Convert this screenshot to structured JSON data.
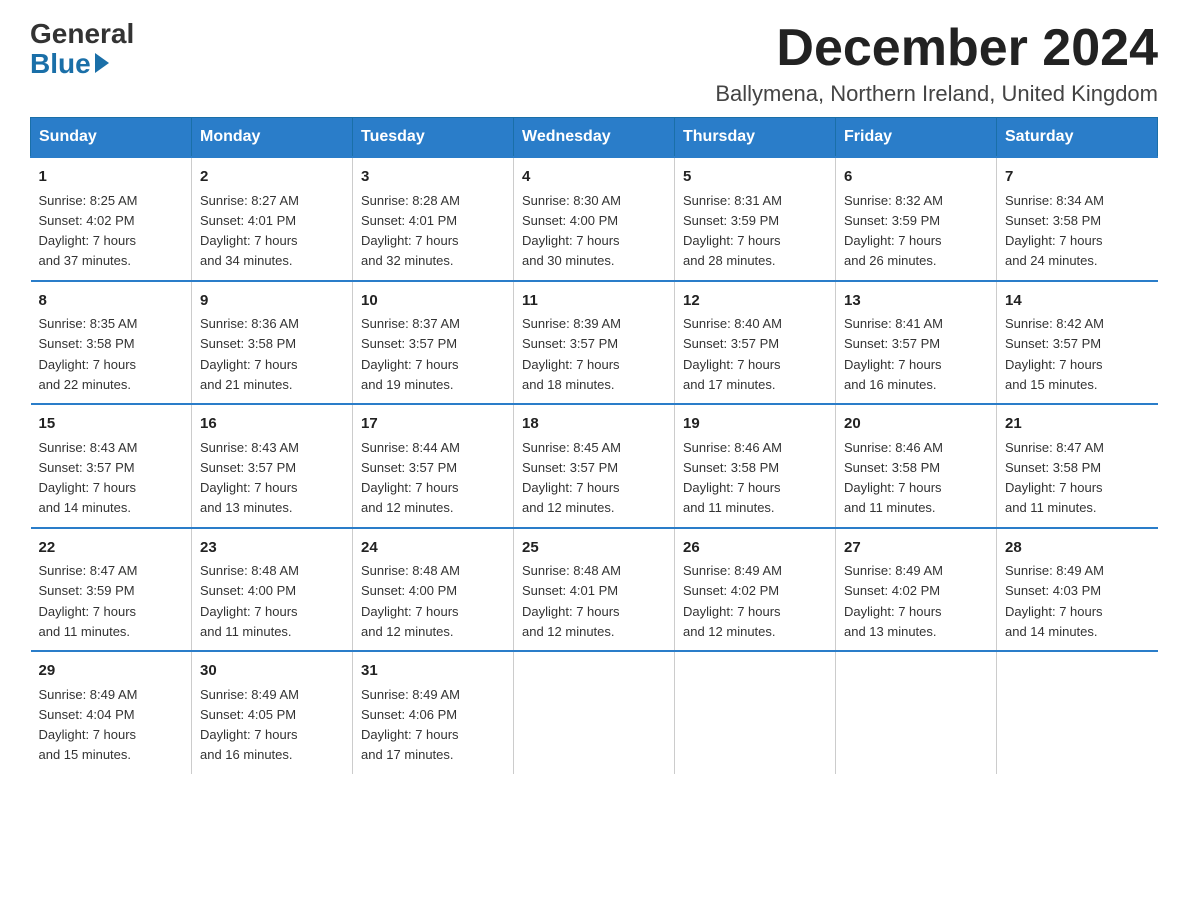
{
  "header": {
    "logo_general": "General",
    "logo_blue": "Blue",
    "month_title": "December 2024",
    "location": "Ballymena, Northern Ireland, United Kingdom"
  },
  "days_of_week": [
    "Sunday",
    "Monday",
    "Tuesday",
    "Wednesday",
    "Thursday",
    "Friday",
    "Saturday"
  ],
  "weeks": [
    [
      {
        "num": "1",
        "sunrise": "8:25 AM",
        "sunset": "4:02 PM",
        "daylight": "7 hours and 37 minutes."
      },
      {
        "num": "2",
        "sunrise": "8:27 AM",
        "sunset": "4:01 PM",
        "daylight": "7 hours and 34 minutes."
      },
      {
        "num": "3",
        "sunrise": "8:28 AM",
        "sunset": "4:01 PM",
        "daylight": "7 hours and 32 minutes."
      },
      {
        "num": "4",
        "sunrise": "8:30 AM",
        "sunset": "4:00 PM",
        "daylight": "7 hours and 30 minutes."
      },
      {
        "num": "5",
        "sunrise": "8:31 AM",
        "sunset": "3:59 PM",
        "daylight": "7 hours and 28 minutes."
      },
      {
        "num": "6",
        "sunrise": "8:32 AM",
        "sunset": "3:59 PM",
        "daylight": "7 hours and 26 minutes."
      },
      {
        "num": "7",
        "sunrise": "8:34 AM",
        "sunset": "3:58 PM",
        "daylight": "7 hours and 24 minutes."
      }
    ],
    [
      {
        "num": "8",
        "sunrise": "8:35 AM",
        "sunset": "3:58 PM",
        "daylight": "7 hours and 22 minutes."
      },
      {
        "num": "9",
        "sunrise": "8:36 AM",
        "sunset": "3:58 PM",
        "daylight": "7 hours and 21 minutes."
      },
      {
        "num": "10",
        "sunrise": "8:37 AM",
        "sunset": "3:57 PM",
        "daylight": "7 hours and 19 minutes."
      },
      {
        "num": "11",
        "sunrise": "8:39 AM",
        "sunset": "3:57 PM",
        "daylight": "7 hours and 18 minutes."
      },
      {
        "num": "12",
        "sunrise": "8:40 AM",
        "sunset": "3:57 PM",
        "daylight": "7 hours and 17 minutes."
      },
      {
        "num": "13",
        "sunrise": "8:41 AM",
        "sunset": "3:57 PM",
        "daylight": "7 hours and 16 minutes."
      },
      {
        "num": "14",
        "sunrise": "8:42 AM",
        "sunset": "3:57 PM",
        "daylight": "7 hours and 15 minutes."
      }
    ],
    [
      {
        "num": "15",
        "sunrise": "8:43 AM",
        "sunset": "3:57 PM",
        "daylight": "7 hours and 14 minutes."
      },
      {
        "num": "16",
        "sunrise": "8:43 AM",
        "sunset": "3:57 PM",
        "daylight": "7 hours and 13 minutes."
      },
      {
        "num": "17",
        "sunrise": "8:44 AM",
        "sunset": "3:57 PM",
        "daylight": "7 hours and 12 minutes."
      },
      {
        "num": "18",
        "sunrise": "8:45 AM",
        "sunset": "3:57 PM",
        "daylight": "7 hours and 12 minutes."
      },
      {
        "num": "19",
        "sunrise": "8:46 AM",
        "sunset": "3:58 PM",
        "daylight": "7 hours and 11 minutes."
      },
      {
        "num": "20",
        "sunrise": "8:46 AM",
        "sunset": "3:58 PM",
        "daylight": "7 hours and 11 minutes."
      },
      {
        "num": "21",
        "sunrise": "8:47 AM",
        "sunset": "3:58 PM",
        "daylight": "7 hours and 11 minutes."
      }
    ],
    [
      {
        "num": "22",
        "sunrise": "8:47 AM",
        "sunset": "3:59 PM",
        "daylight": "7 hours and 11 minutes."
      },
      {
        "num": "23",
        "sunrise": "8:48 AM",
        "sunset": "4:00 PM",
        "daylight": "7 hours and 11 minutes."
      },
      {
        "num": "24",
        "sunrise": "8:48 AM",
        "sunset": "4:00 PM",
        "daylight": "7 hours and 12 minutes."
      },
      {
        "num": "25",
        "sunrise": "8:48 AM",
        "sunset": "4:01 PM",
        "daylight": "7 hours and 12 minutes."
      },
      {
        "num": "26",
        "sunrise": "8:49 AM",
        "sunset": "4:02 PM",
        "daylight": "7 hours and 12 minutes."
      },
      {
        "num": "27",
        "sunrise": "8:49 AM",
        "sunset": "4:02 PM",
        "daylight": "7 hours and 13 minutes."
      },
      {
        "num": "28",
        "sunrise": "8:49 AM",
        "sunset": "4:03 PM",
        "daylight": "7 hours and 14 minutes."
      }
    ],
    [
      {
        "num": "29",
        "sunrise": "8:49 AM",
        "sunset": "4:04 PM",
        "daylight": "7 hours and 15 minutes."
      },
      {
        "num": "30",
        "sunrise": "8:49 AM",
        "sunset": "4:05 PM",
        "daylight": "7 hours and 16 minutes."
      },
      {
        "num": "31",
        "sunrise": "8:49 AM",
        "sunset": "4:06 PM",
        "daylight": "7 hours and 17 minutes."
      },
      null,
      null,
      null,
      null
    ]
  ]
}
